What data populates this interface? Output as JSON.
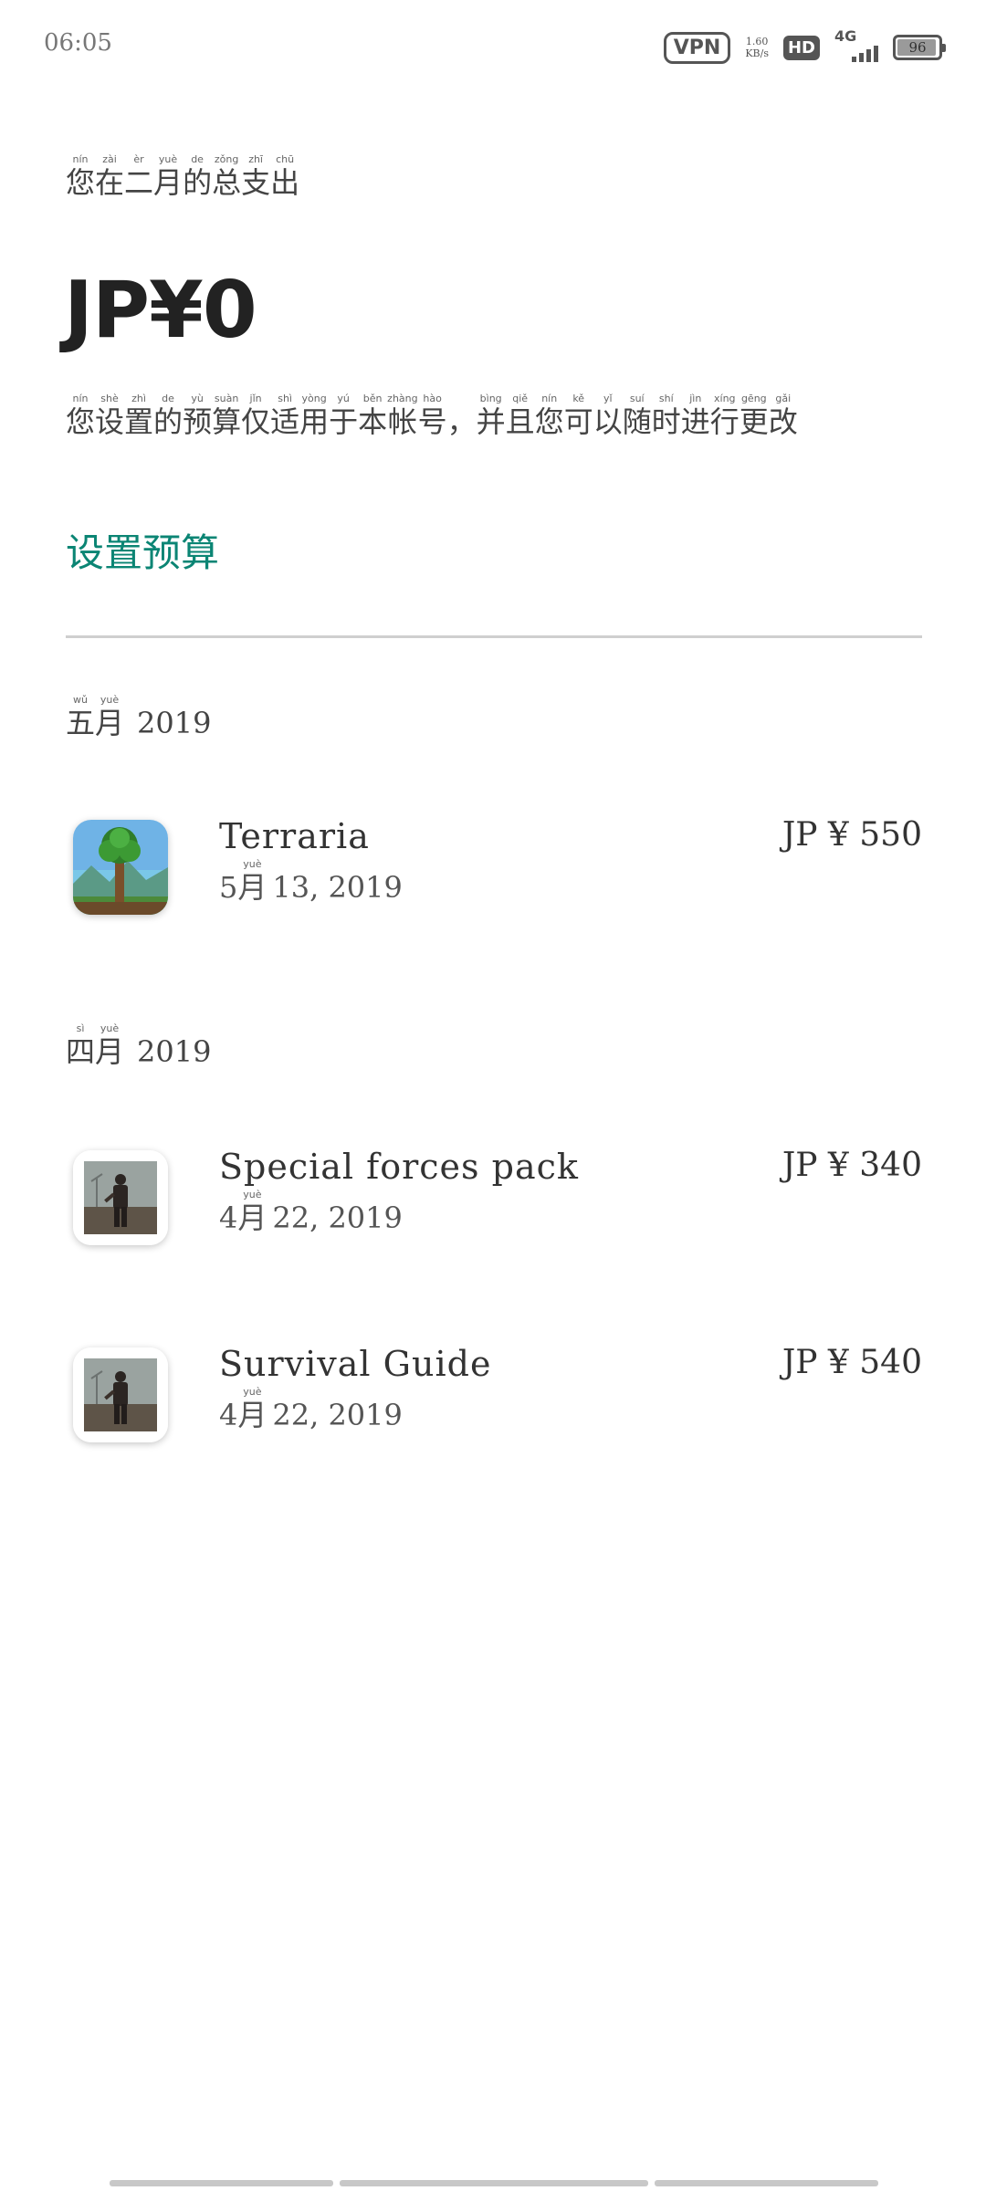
{
  "status_bar": {
    "time": "06:05",
    "vpn": "VPN",
    "net_speed_value": "1.60",
    "net_speed_unit": "KB/s",
    "hd": "HD",
    "network_type": "4G",
    "signal_level": 0.8,
    "battery": "96",
    "battery_level": 0.96
  },
  "summary": {
    "subtitle": [
      {
        "py": "nín",
        "hz": "您"
      },
      {
        "py": "zài",
        "hz": "在"
      },
      {
        "py": "èr",
        "hz": "二"
      },
      {
        "py": "yuè",
        "hz": "月"
      },
      {
        "py": "de",
        "hz": "的"
      },
      {
        "py": "zǒng",
        "hz": "总"
      },
      {
        "py": "zhī",
        "hz": "支"
      },
      {
        "py": "chū",
        "hz": "出"
      }
    ],
    "amount": "JP¥0",
    "note": [
      {
        "py": "nín",
        "hz": "您"
      },
      {
        "py": "shè",
        "hz": "设"
      },
      {
        "py": "zhì",
        "hz": "置"
      },
      {
        "py": "de",
        "hz": "的"
      },
      {
        "py": "yù",
        "hz": "预"
      },
      {
        "py": "suàn",
        "hz": "算"
      },
      {
        "py": "jǐn",
        "hz": "仅"
      },
      {
        "py": "shì",
        "hz": "适"
      },
      {
        "py": "yòng",
        "hz": "用"
      },
      {
        "py": "yú",
        "hz": "于"
      },
      {
        "py": "běn",
        "hz": "本"
      },
      {
        "py": "zhàng",
        "hz": "帐"
      },
      {
        "py": "hào",
        "hz": "号"
      },
      {
        "py": "",
        "hz": "，"
      },
      {
        "py": "bìng",
        "hz": "并"
      },
      {
        "py": "qiě",
        "hz": "且"
      },
      {
        "py": "nín",
        "hz": "您"
      },
      {
        "py": "kě",
        "hz": "可"
      },
      {
        "py": "yǐ",
        "hz": "以"
      },
      {
        "py": "suí",
        "hz": "随"
      },
      {
        "py": "shí",
        "hz": "时"
      },
      {
        "py": "jìn",
        "hz": "进"
      },
      {
        "py": "xíng",
        "hz": "行"
      },
      {
        "py": "gēng",
        "hz": "更"
      },
      {
        "py": "gǎi",
        "hz": "改"
      }
    ],
    "set_budget_label": "设置预算"
  },
  "months": [
    {
      "label": [
        {
          "py": "wǔ",
          "hz": "五"
        },
        {
          "py": "yuè",
          "hz": "月"
        }
      ],
      "year": "2019",
      "items": [
        {
          "title": "Terraria",
          "date_prefix": "5",
          "date_month_py": "yuè",
          "date_month_hz": "月",
          "date_rest": "13, 2019",
          "price": "JP ¥ 550",
          "icon": "terraria-app-icon"
        }
      ]
    },
    {
      "label": [
        {
          "py": "sì",
          "hz": "四"
        },
        {
          "py": "yuè",
          "hz": "月"
        }
      ],
      "year": "2019",
      "items": [
        {
          "title": "Special forces pack",
          "date_prefix": "4",
          "date_month_py": "yuè",
          "date_month_hz": "月",
          "date_rest": "22, 2019",
          "price": "JP ¥ 340",
          "icon": "survival-game-app-icon"
        },
        {
          "title": "Survival Guide",
          "date_prefix": "4",
          "date_month_py": "yuè",
          "date_month_hz": "月",
          "date_rest": "22, 2019",
          "price": "JP ¥ 540",
          "icon": "survival-game-app-icon"
        }
      ]
    }
  ],
  "colors": {
    "accent": "#0b8574",
    "text": "#333333",
    "divider": "#cfcfcf"
  }
}
